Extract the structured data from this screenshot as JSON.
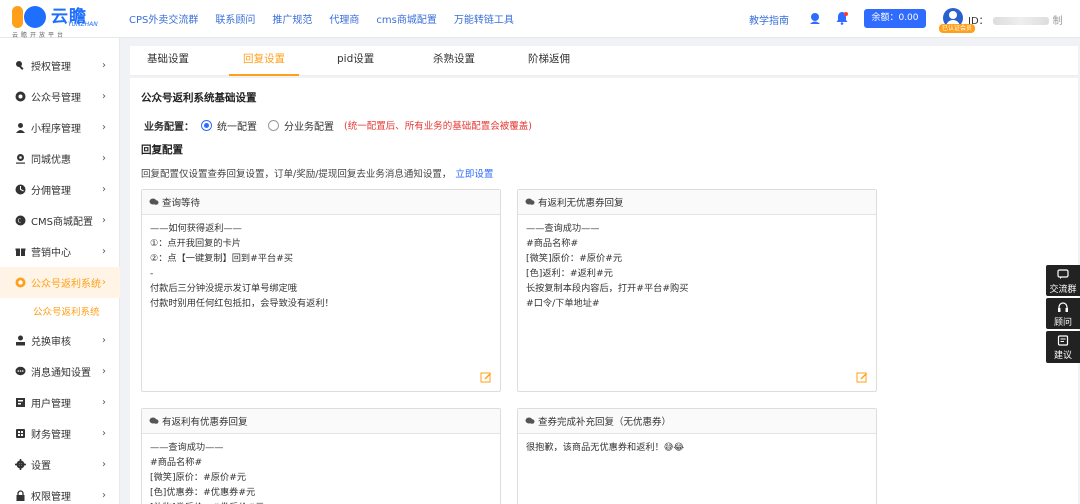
{
  "header": {
    "logo": {
      "brand": "云瞻",
      "brand_en": "YUNZHAN",
      "tagline": "云瞻开放平台"
    },
    "nav": [
      "CPS外卖交流群",
      "联系顾问",
      "推广规范",
      "代理商",
      "cms商城配置",
      "万能转链工具"
    ],
    "help_link": "教学指南",
    "balance": "余额：0.00",
    "user": {
      "id_label": "ID：",
      "badge": "已认证会员",
      "tail": "制"
    }
  },
  "sidebar": {
    "items": [
      {
        "label": "授权管理",
        "icon": "key-icon"
      },
      {
        "label": "公众号管理",
        "icon": "wechat-icon"
      },
      {
        "label": "小程序管理",
        "icon": "miniapp-icon"
      },
      {
        "label": "同城优惠",
        "icon": "location-icon"
      },
      {
        "label": "分佣管理",
        "icon": "commission-icon"
      },
      {
        "label": "CMS商城配置",
        "icon": "cms-icon"
      },
      {
        "label": "营销中心",
        "icon": "gift-icon"
      },
      {
        "label": "公众号返利系统",
        "icon": "rebate-icon",
        "active": true
      },
      {
        "label": "兑换审核",
        "icon": "audit-icon"
      },
      {
        "label": "消息通知设置",
        "icon": "message-icon"
      },
      {
        "label": "用户管理",
        "icon": "users-icon"
      },
      {
        "label": "财务管理",
        "icon": "finance-icon"
      },
      {
        "label": "设置",
        "icon": "gear-icon"
      },
      {
        "label": "权限管理",
        "icon": "lock-icon"
      }
    ],
    "sub_item": "公众号返利系统",
    "chevron": "›"
  },
  "tabs": [
    "基础设置",
    "回复设置",
    "pid设置",
    "杀熟设置",
    "阶梯返佣"
  ],
  "active_tab": 1,
  "content": {
    "section_title": "公众号返利系统基础设置",
    "mode_label": "业务配置：",
    "mode_options": [
      "统一配置",
      "分业务配置"
    ],
    "mode_selected": 0,
    "mode_warning": "(统一配置后、所有业务的基础配置会被覆盖)",
    "reply_title": "回复配置",
    "reply_desc": "回复配置仅设置查券回复设置，订单/奖励/提现回复去业务消息通知设置，",
    "reply_link": "立即设置",
    "cards": [
      {
        "title": "查询等待",
        "body": "——如何获得返利——\n①：点开我回复的卡片\n②：点【一键复制】回到#平台#买\n-\n付款后三分钟没提示发订单号绑定哦\n付款时别用任何红包抵扣，会导致没有返利！"
      },
      {
        "title": "有返利无优惠券回复",
        "body": "——查询成功——\n#商品名称#\n[微笑]原价：#原价#元\n[色]返利：#返利#元\n长按复制本段内容后，打开#平台#购买\n#口令/下单地址#"
      },
      {
        "title": "有返利有优惠券回复",
        "body": "——查询成功——\n#商品名称#\n[微笑]原价：#原价#元\n[色]优惠券：#优惠券#元\n[礼物]券后价：#券后价#元"
      },
      {
        "title": "查券完成补充回复（无优惠券）",
        "body": "很抱歉，该商品无优惠券和返利！😅😂"
      }
    ]
  },
  "float_panel": [
    "交流群",
    "顾问",
    "建议"
  ]
}
